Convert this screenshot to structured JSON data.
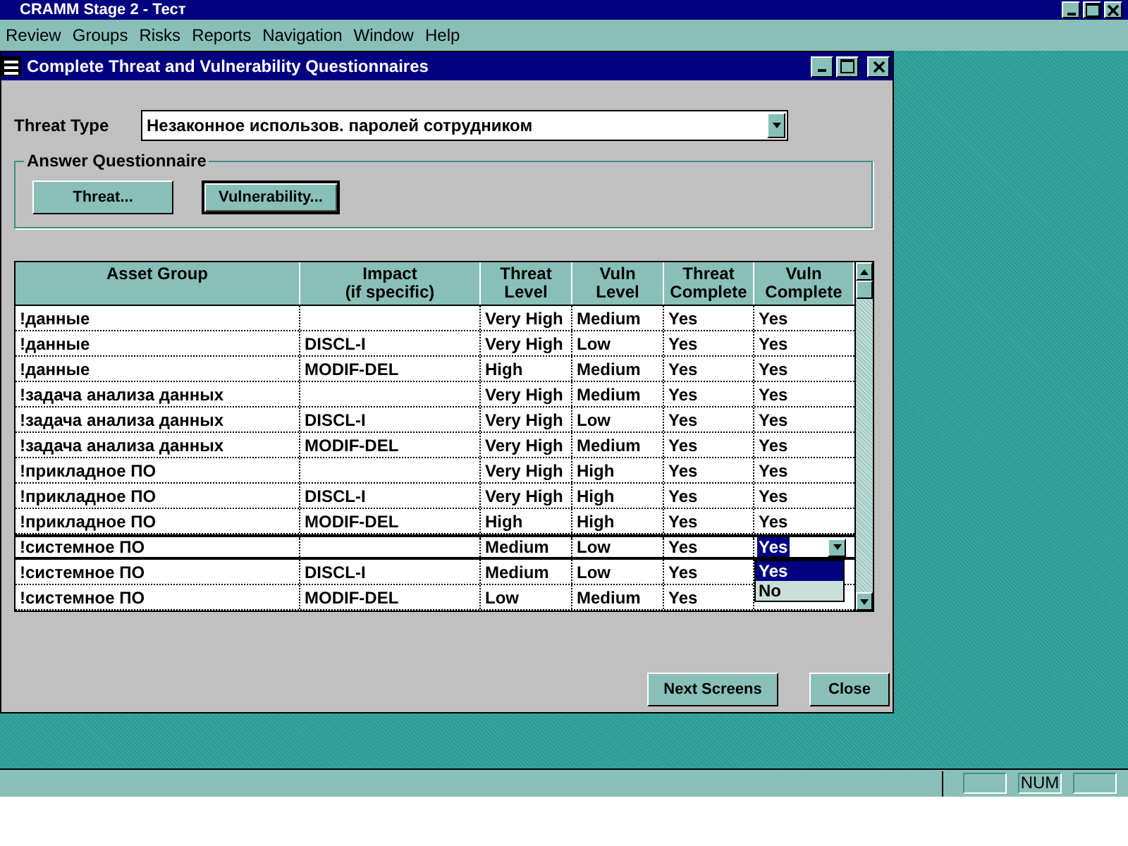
{
  "app_title": "CRAMM Stage 2 - Тест",
  "menu": [
    {
      "label": "Review"
    },
    {
      "label": "Groups"
    },
    {
      "label": "Risks"
    },
    {
      "label": "Reports"
    },
    {
      "label": "Navigation"
    },
    {
      "label": "Window"
    },
    {
      "label": "Help"
    }
  ],
  "window": {
    "title": "Complete Threat and Vulnerability Questionnaires"
  },
  "threat_type": {
    "label": "Threat Type",
    "value": "Незаконное использов. паролей сотрудником"
  },
  "answer_questionnaire": {
    "legend": "Answer Questionnaire",
    "buttons": [
      {
        "label": "Threat...",
        "focused": false
      },
      {
        "label": "Vulnerability...",
        "focused": true
      }
    ]
  },
  "table": {
    "columns": [
      "Asset Group",
      "Impact\n(if specific)",
      "Threat\nLevel",
      "Vuln\nLevel",
      "Threat\nComplete",
      "Vuln\nComplete"
    ],
    "rows": [
      {
        "selected": false,
        "cells": [
          "!данные",
          "",
          "Very High",
          "Medium",
          "Yes",
          "Yes"
        ]
      },
      {
        "selected": false,
        "cells": [
          "!данные",
          "DISCL-I",
          "Very High",
          "Low",
          "Yes",
          "Yes"
        ]
      },
      {
        "selected": false,
        "cells": [
          "!данные",
          "MODIF-DEL",
          "High",
          "Medium",
          "Yes",
          "Yes"
        ]
      },
      {
        "selected": false,
        "cells": [
          "!задача анализа данных",
          "",
          "Very High",
          "Medium",
          "Yes",
          "Yes"
        ]
      },
      {
        "selected": false,
        "cells": [
          "!задача анализа данных",
          "DISCL-I",
          "Very High",
          "Low",
          "Yes",
          "Yes"
        ]
      },
      {
        "selected": false,
        "cells": [
          "!задача анализа данных",
          "MODIF-DEL",
          "Very High",
          "Medium",
          "Yes",
          "Yes"
        ]
      },
      {
        "selected": false,
        "cells": [
          "!прикладное ПО",
          "",
          "Very High",
          "High",
          "Yes",
          "Yes"
        ]
      },
      {
        "selected": false,
        "cells": [
          "!прикладное ПО",
          "DISCL-I",
          "Very High",
          "High",
          "Yes",
          "Yes"
        ]
      },
      {
        "selected": false,
        "cells": [
          "!прикладное ПО",
          "MODIF-DEL",
          "High",
          "High",
          "Yes",
          "Yes"
        ]
      },
      {
        "selected": true,
        "cells": [
          "!системное ПО",
          "",
          "Medium",
          "Low",
          "Yes"
        ],
        "editor": {
          "value": "Yes",
          "options": [
            {
              "label": "Yes",
              "selected": true
            },
            {
              "label": "No",
              "selected": false
            }
          ]
        }
      },
      {
        "selected": false,
        "cells": [
          "!системное ПО",
          "DISCL-I",
          "Medium",
          "Low",
          "Yes"
        ]
      },
      {
        "selected": false,
        "cells": [
          "!системное ПО",
          "MODIF-DEL",
          "Low",
          "Medium",
          "Yes"
        ]
      }
    ]
  },
  "footer_buttons": [
    {
      "label": "Next Screens"
    },
    {
      "label": "Close"
    }
  ],
  "status_bar": {
    "panels": [
      {
        "kind": "blank"
      },
      {
        "kind": "text",
        "text": "NUM"
      },
      {
        "kind": "blank"
      }
    ]
  }
}
